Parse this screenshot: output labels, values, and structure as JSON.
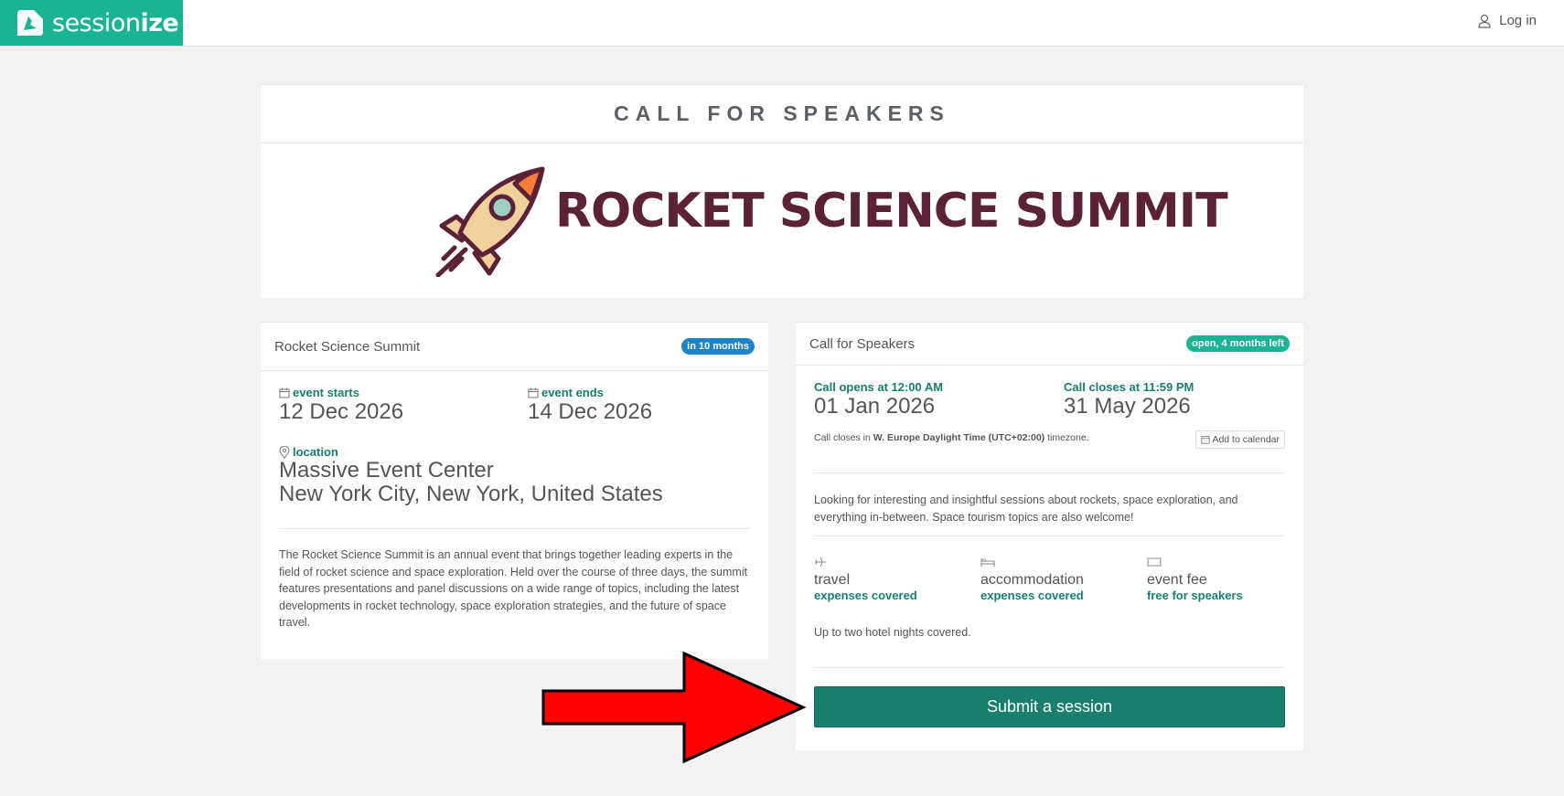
{
  "topbar": {
    "brand_text_light": "session",
    "brand_text_bold": "ize",
    "login_label": "Log in"
  },
  "header": {
    "call_title": "CALL FOR SPEAKERS",
    "event_logo_text": "ROCKET SCIENCE SUMMIT"
  },
  "event_card": {
    "title": "Rocket Science Summit",
    "badge": "in 10 months",
    "starts_label": "event starts",
    "starts_value": "12 Dec 2026",
    "ends_label": "event ends",
    "ends_value": "14 Dec 2026",
    "location_label": "location",
    "location_line1": "Massive Event Center",
    "location_line2": "New York City, New York, United States",
    "description": "The Rocket Science Summit is an annual event that brings together leading experts in the field of rocket science and space exploration. Held over the course of three days, the summit features presentations and panel discussions on a wide range of topics, including the latest developments in rocket technology, space exploration strategies, and the future of space travel."
  },
  "cfs_card": {
    "title": "Call for Speakers",
    "badge": "open, 4 months left",
    "opens_label": "Call opens at 12:00 AM",
    "opens_value": "01 Jan 2026",
    "closes_label": "Call closes at 11:59 PM",
    "closes_value": "31 May 2026",
    "tz_prefix": "Call closes in ",
    "tz_name": "W. Europe Daylight Time (UTC+02:00)",
    "tz_suffix": " timezone.",
    "add_calendar": "Add to calendar",
    "description": "Looking for interesting and insightful sessions about rockets, space exploration, and everything in-between. Space tourism topics are also welcome!",
    "expenses": [
      {
        "icon": "plane-icon",
        "title": "travel",
        "value": "expenses covered"
      },
      {
        "icon": "bed-icon",
        "title": "accommodation",
        "value": "expenses covered"
      },
      {
        "icon": "ticket-icon",
        "title": "event fee",
        "value": "free for speakers"
      }
    ],
    "expenses_note": "Up to two hotel nights covered.",
    "submit_label": "Submit a session"
  },
  "colors": {
    "brand": "#1ab394",
    "accent_dark": "#187f6c",
    "badge_blue": "#1c84c6",
    "logo_text": "#5b2237",
    "arrow": "#ff0000"
  }
}
